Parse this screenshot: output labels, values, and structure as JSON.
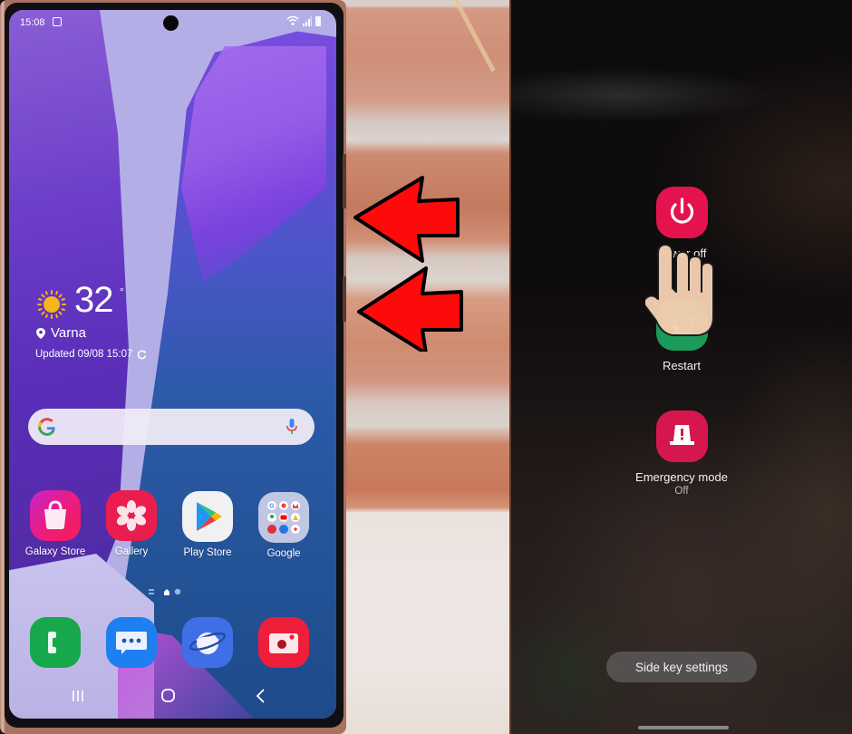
{
  "left_phone": {
    "status_bar": {
      "time": "15:08",
      "icons": [
        "notification-gallery-icon",
        "wifi-icon",
        "signal-icon",
        "battery-icon"
      ]
    },
    "weather_widget": {
      "icon": "sun-icon",
      "temperature": "32",
      "degree_symbol": "°",
      "location_icon": "location-pin-icon",
      "location": "Varna",
      "updated_text": "Updated 09/08 15:07",
      "refresh_icon": "refresh-icon"
    },
    "google_search_bar": {
      "logo": "google-g-icon",
      "mic_icon": "microphone-icon"
    },
    "apps": [
      {
        "label": "Galaxy Store",
        "icon": "shopping-bag-icon",
        "color": "#e7208a"
      },
      {
        "label": "Gallery",
        "icon": "flower-icon",
        "color": "#ea1d4f"
      },
      {
        "label": "Play Store",
        "icon": "play-triangle-icon",
        "color": "#f1f1f4"
      },
      {
        "label": "Google",
        "icon": "app-folder-icon",
        "color": "#dcdcf0"
      }
    ],
    "page_indicator": {
      "pages": [
        "menu",
        "home",
        "page"
      ],
      "active": "home"
    },
    "dock": [
      {
        "name": "phone",
        "icon": "phone-handset-icon",
        "color": "#16a84b"
      },
      {
        "name": "messages",
        "icon": "chat-bubble-icon",
        "color": "#1d7ff0"
      },
      {
        "name": "internet",
        "icon": "planet-icon",
        "color": "#3f6fe6"
      },
      {
        "name": "camera",
        "icon": "camera-icon",
        "color": "#ef1e3a"
      }
    ],
    "nav_bar": {
      "recents_icon": "recent-apps-icon",
      "home_icon": "home-button-icon",
      "back_icon": "back-arrow-icon"
    }
  },
  "annotations": {
    "arrows": [
      {
        "points_to": "volume-up / side key area",
        "color": "#ff0a0a"
      },
      {
        "points_to": "side key",
        "color": "#ff0a0a"
      }
    ]
  },
  "power_menu": {
    "items": [
      {
        "label": "Power off",
        "icon": "power-icon",
        "color": "#e5134d"
      },
      {
        "label": "Restart",
        "icon": "restart-icon",
        "color": "#1a9b5a"
      },
      {
        "label": "Emergency mode",
        "sublabel": "Off",
        "icon": "emergency-beacon-icon",
        "color": "#d6174e"
      }
    ],
    "side_key_settings_label": "Side key settings",
    "hand_pointer": "tapping-hand-icon"
  }
}
